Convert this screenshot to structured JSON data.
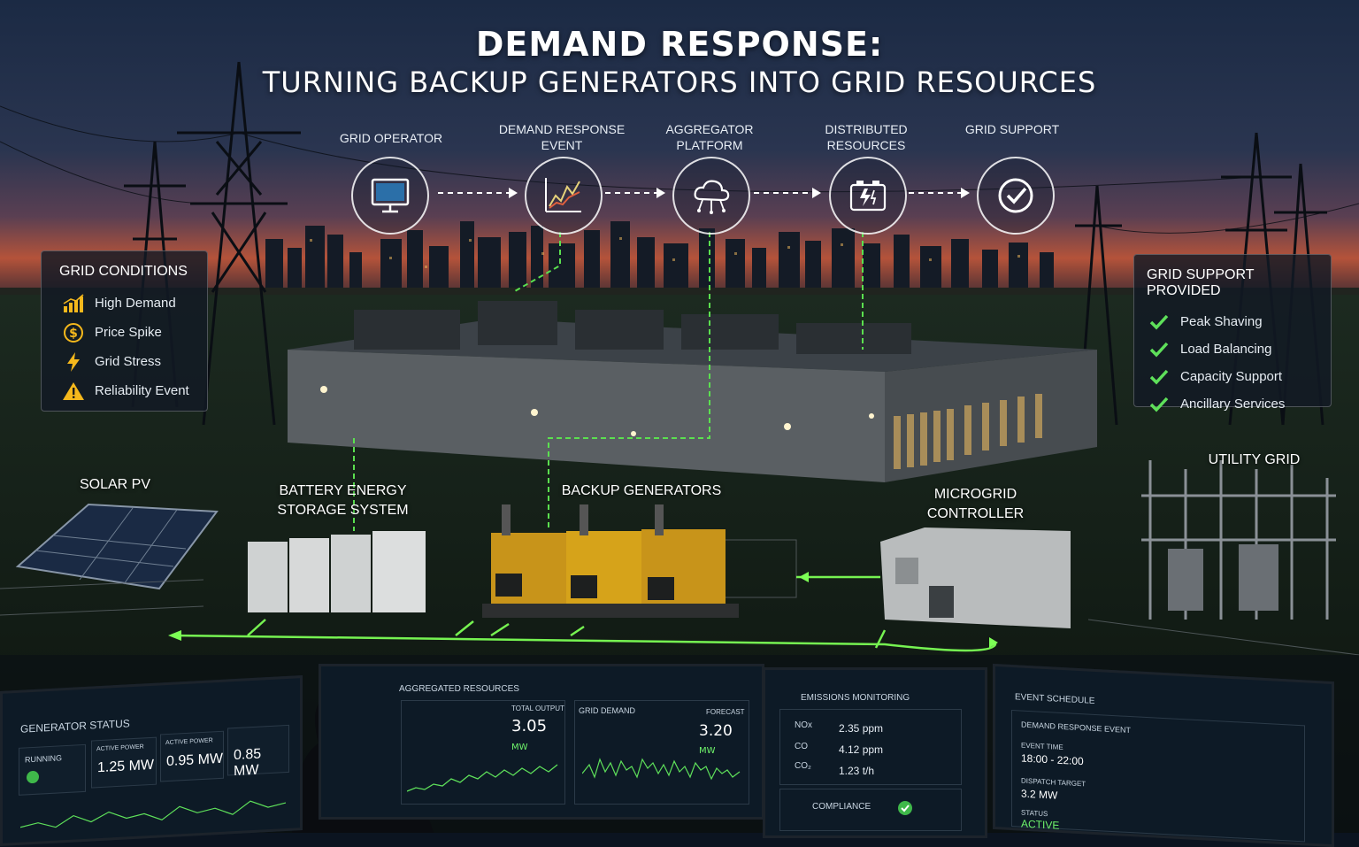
{
  "title": {
    "line1": "DEMAND RESPONSE:",
    "line2": "TURNING BACKUP GENERATORS INTO GRID RESOURCES"
  },
  "flow": [
    {
      "label": "GRID OPERATOR",
      "icon": "monitor-icon"
    },
    {
      "label": "DEMAND RESPONSE EVENT",
      "icon": "chart-icon"
    },
    {
      "label": "AGGREGATOR PLATFORM",
      "icon": "cloud-icon"
    },
    {
      "label": "DISTRIBUTED RESOURCES",
      "icon": "battery-icon"
    },
    {
      "label": "GRID SUPPORT",
      "icon": "check-circle-icon"
    }
  ],
  "grid_conditions": {
    "title": "GRID CONDITIONS",
    "items": [
      {
        "label": "High Demand",
        "icon": "bar-trend-icon"
      },
      {
        "label": "Price Spike",
        "icon": "dollar-icon"
      },
      {
        "label": "Grid Stress",
        "icon": "lightning-icon"
      },
      {
        "label": "Reliability Event",
        "icon": "warning-icon"
      }
    ]
  },
  "grid_support": {
    "title": "GRID SUPPORT PROVIDED",
    "items": [
      {
        "label": "Peak Shaving"
      },
      {
        "label": "Load Balancing"
      },
      {
        "label": "Capacity Support"
      },
      {
        "label": "Ancillary Services"
      }
    ]
  },
  "zones": {
    "solar": "SOLAR PV",
    "battery": "BATTERY ENERGY STORAGE SYSTEM",
    "generators": "BACKUP GENERATORS",
    "microgrid": "MICROGRID CONTROLLER",
    "utility": "UTILITY GRID"
  },
  "screens": {
    "generator_status": {
      "title": "GENERATOR STATUS",
      "running": "RUNNING",
      "active_power_label": "ACTIVE POWER",
      "values": [
        "1.25 MW",
        "0.95 MW",
        "0.85 MW"
      ]
    },
    "aggregated": {
      "title": "AGGREGATED RESOURCES",
      "total_output_label": "TOTAL OUTPUT",
      "total_output_value": "3.05",
      "unit": "MW",
      "grid_demand_label": "GRID DEMAND",
      "forecast_label": "FORECAST",
      "forecast_value": "3.20"
    },
    "emissions": {
      "title": "EMISSIONS MONITORING",
      "rows": [
        {
          "label": "NOx",
          "value": "2.35 ppm"
        },
        {
          "label": "CO",
          "value": "4.12 ppm"
        },
        {
          "label": "CO₂",
          "value": "1.23 t/h"
        }
      ],
      "compliance": "COMPLIANCE"
    },
    "event_schedule": {
      "title": "EVENT SCHEDULE",
      "event_label": "DEMAND RESPONSE EVENT",
      "event_time_label": "EVENT TIME",
      "event_time": "18:00 - 22:00",
      "dispatch_label": "DISPATCH TARGET",
      "dispatch_value": "3.2 MW",
      "status_label": "STATUS",
      "status_value": "ACTIVE"
    }
  },
  "colors": {
    "accent_green": "#6ff46b",
    "warning_yellow": "#f5b81c",
    "generator_yellow": "#d6a31a"
  }
}
